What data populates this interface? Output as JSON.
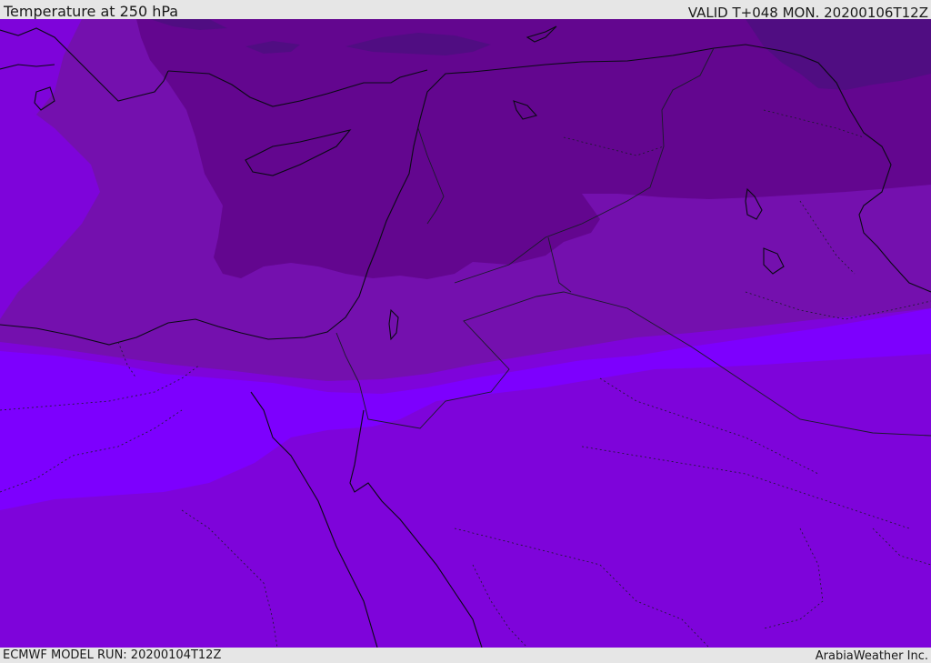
{
  "header": {
    "title": "Temperature at 250 hPa",
    "valid": "VALID T+048 MON. 20200106T12Z"
  },
  "footer": {
    "model_run": "ECMWF MODEL RUN: 20200104T12Z",
    "credit": "ArabiaWeather Inc."
  },
  "map": {
    "variable": "temperature",
    "pressure_level_hpa": 250,
    "colors": {
      "band_darkest": "#500d82",
      "band_dark": "#63068f",
      "band_mid": "#7410ae",
      "band_light": "#7e04da",
      "band_bright": "#7d00fe",
      "band_blue": "#6a16fd",
      "coastline": "#0a0a14",
      "border": "#1a1a2a"
    }
  }
}
